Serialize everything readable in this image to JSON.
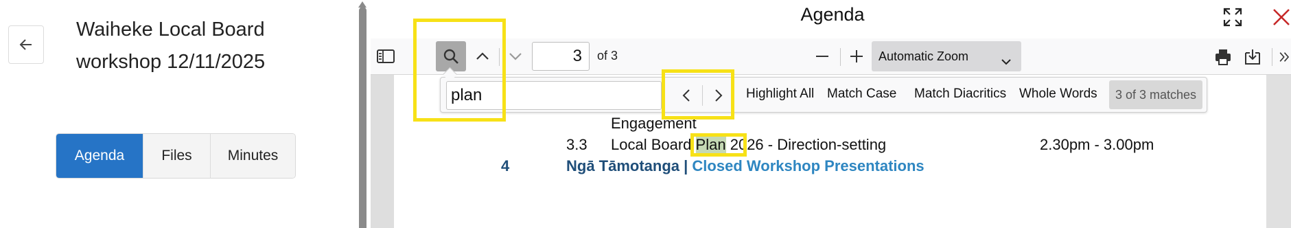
{
  "sidebar": {
    "title": "Waiheke Local Board workshop 12/11/2025",
    "tabs": [
      {
        "label": "Agenda",
        "active": true
      },
      {
        "label": "Files",
        "active": false
      },
      {
        "label": "Minutes",
        "active": false
      }
    ]
  },
  "viewer": {
    "title": "Agenda",
    "icons": {
      "expand": "expand-icon",
      "close": "close-icon"
    },
    "toolbar": {
      "page_number": "3",
      "page_count": "of 3",
      "zoom": "Automatic Zoom"
    },
    "find": {
      "query": "plan",
      "options": [
        "Highlight All",
        "Match Case",
        "Match Diacritics",
        "Whole Words"
      ],
      "result": "3 of 3 matches"
    },
    "document": {
      "line_engagement": "Engagement",
      "item_3_3_num": "3.3",
      "item_3_3_pre": "Local Board",
      "item_3_3_match": "Plan",
      "item_3_3_post": "2026 - Direction-setting",
      "item_3_3_time": "2.30pm - 3.00pm",
      "item_4_num": "4",
      "item_4_part1": "Ngā Tāmotanga |",
      "item_4_part2": "Closed Workshop Presentations"
    }
  },
  "colors": {
    "accent": "#2674c6",
    "highlight_box": "#f7e117",
    "close_red": "#c62828"
  }
}
